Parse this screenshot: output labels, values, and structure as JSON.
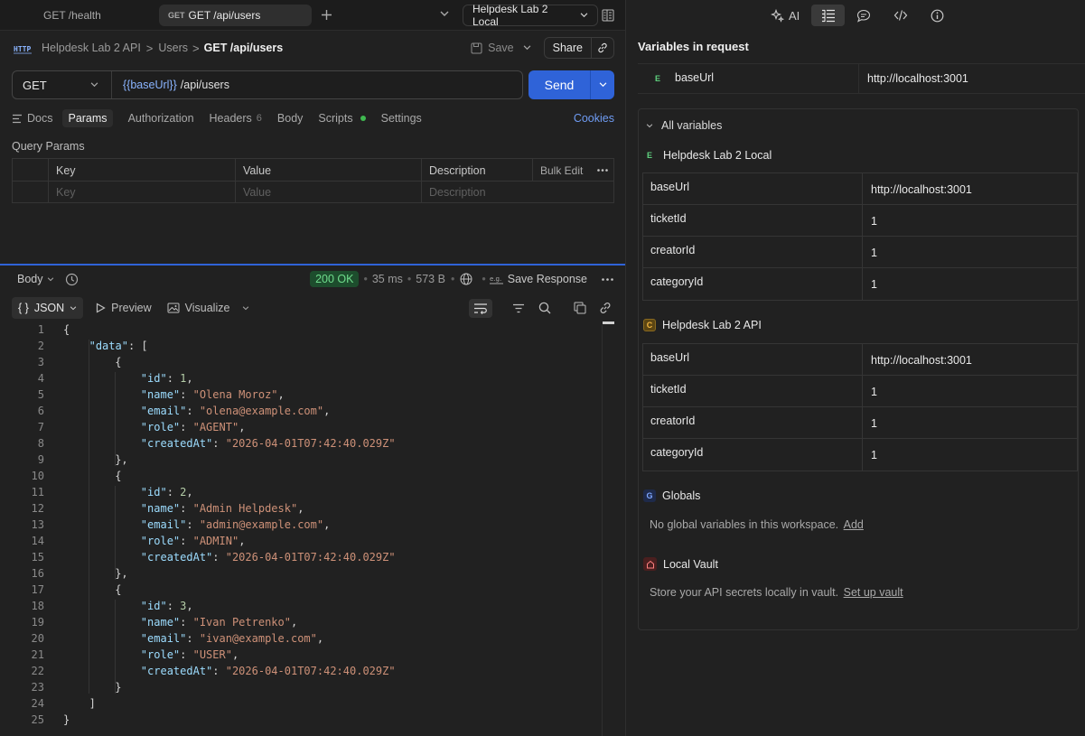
{
  "tabs": [
    {
      "method": "GET",
      "label": "GET /health"
    },
    {
      "method": "GET",
      "label": "GET /api/users"
    }
  ],
  "environment": "Helpdesk Lab 2 Local",
  "breadcrumb": {
    "collection": "Helpdesk Lab 2 API",
    "folder": "Users",
    "current": "GET /api/users",
    "separator": ">"
  },
  "toolbar": {
    "save": "Save",
    "share": "Share"
  },
  "request": {
    "method": "GET",
    "url_var": "{{baseUrl}}",
    "url_path": "/api/users",
    "send": "Send"
  },
  "req_tabs": {
    "docs": "Docs",
    "params": "Params",
    "authorization": "Authorization",
    "headers": "Headers",
    "headers_count": "6",
    "body": "Body",
    "scripts": "Scripts",
    "settings": "Settings",
    "cookies": "Cookies"
  },
  "query_params": {
    "title": "Query Params",
    "headers": [
      "Key",
      "Value",
      "Description",
      "Bulk Edit"
    ],
    "placeholders": [
      "Key",
      "Value",
      "Description"
    ]
  },
  "response": {
    "body_label": "Body",
    "status": "200 OK",
    "time": "35 ms",
    "size": "573 B",
    "save_response": "Save Response",
    "format": "JSON",
    "preview": "Preview",
    "visualize": "Visualize",
    "lines": [
      {
        "n": "1",
        "indent": 0,
        "tokens": [
          {
            "t": "p",
            "v": "{"
          }
        ]
      },
      {
        "n": "2",
        "indent": 1,
        "tokens": [
          {
            "t": "k",
            "v": "\"data\""
          },
          {
            "t": "p",
            "v": ": ["
          }
        ]
      },
      {
        "n": "3",
        "indent": 2,
        "tokens": [
          {
            "t": "p",
            "v": "{"
          }
        ]
      },
      {
        "n": "4",
        "indent": 3,
        "tokens": [
          {
            "t": "k",
            "v": "\"id\""
          },
          {
            "t": "p",
            "v": ": "
          },
          {
            "t": "n",
            "v": "1"
          },
          {
            "t": "p",
            "v": ","
          }
        ]
      },
      {
        "n": "5",
        "indent": 3,
        "tokens": [
          {
            "t": "k",
            "v": "\"name\""
          },
          {
            "t": "p",
            "v": ": "
          },
          {
            "t": "s",
            "v": "\"Olena Moroz\""
          },
          {
            "t": "p",
            "v": ","
          }
        ]
      },
      {
        "n": "6",
        "indent": 3,
        "tokens": [
          {
            "t": "k",
            "v": "\"email\""
          },
          {
            "t": "p",
            "v": ": "
          },
          {
            "t": "s",
            "v": "\"olena@example.com\""
          },
          {
            "t": "p",
            "v": ","
          }
        ]
      },
      {
        "n": "7",
        "indent": 3,
        "tokens": [
          {
            "t": "k",
            "v": "\"role\""
          },
          {
            "t": "p",
            "v": ": "
          },
          {
            "t": "s",
            "v": "\"AGENT\""
          },
          {
            "t": "p",
            "v": ","
          }
        ]
      },
      {
        "n": "8",
        "indent": 3,
        "tokens": [
          {
            "t": "k",
            "v": "\"createdAt\""
          },
          {
            "t": "p",
            "v": ": "
          },
          {
            "t": "s",
            "v": "\"2026-04-01T07:42:40.029Z\""
          }
        ]
      },
      {
        "n": "9",
        "indent": 2,
        "tokens": [
          {
            "t": "p",
            "v": "},"
          }
        ]
      },
      {
        "n": "10",
        "indent": 2,
        "tokens": [
          {
            "t": "p",
            "v": "{"
          }
        ]
      },
      {
        "n": "11",
        "indent": 3,
        "tokens": [
          {
            "t": "k",
            "v": "\"id\""
          },
          {
            "t": "p",
            "v": ": "
          },
          {
            "t": "n",
            "v": "2"
          },
          {
            "t": "p",
            "v": ","
          }
        ]
      },
      {
        "n": "12",
        "indent": 3,
        "tokens": [
          {
            "t": "k",
            "v": "\"name\""
          },
          {
            "t": "p",
            "v": ": "
          },
          {
            "t": "s",
            "v": "\"Admin Helpdesk\""
          },
          {
            "t": "p",
            "v": ","
          }
        ]
      },
      {
        "n": "13",
        "indent": 3,
        "tokens": [
          {
            "t": "k",
            "v": "\"email\""
          },
          {
            "t": "p",
            "v": ": "
          },
          {
            "t": "s",
            "v": "\"admin@example.com\""
          },
          {
            "t": "p",
            "v": ","
          }
        ]
      },
      {
        "n": "14",
        "indent": 3,
        "tokens": [
          {
            "t": "k",
            "v": "\"role\""
          },
          {
            "t": "p",
            "v": ": "
          },
          {
            "t": "s",
            "v": "\"ADMIN\""
          },
          {
            "t": "p",
            "v": ","
          }
        ]
      },
      {
        "n": "15",
        "indent": 3,
        "tokens": [
          {
            "t": "k",
            "v": "\"createdAt\""
          },
          {
            "t": "p",
            "v": ": "
          },
          {
            "t": "s",
            "v": "\"2026-04-01T07:42:40.029Z\""
          }
        ]
      },
      {
        "n": "16",
        "indent": 2,
        "tokens": [
          {
            "t": "p",
            "v": "},"
          }
        ]
      },
      {
        "n": "17",
        "indent": 2,
        "tokens": [
          {
            "t": "p",
            "v": "{"
          }
        ]
      },
      {
        "n": "18",
        "indent": 3,
        "tokens": [
          {
            "t": "k",
            "v": "\"id\""
          },
          {
            "t": "p",
            "v": ": "
          },
          {
            "t": "n",
            "v": "3"
          },
          {
            "t": "p",
            "v": ","
          }
        ]
      },
      {
        "n": "19",
        "indent": 3,
        "tokens": [
          {
            "t": "k",
            "v": "\"name\""
          },
          {
            "t": "p",
            "v": ": "
          },
          {
            "t": "s",
            "v": "\"Ivan Petrenko\""
          },
          {
            "t": "p",
            "v": ","
          }
        ]
      },
      {
        "n": "20",
        "indent": 3,
        "tokens": [
          {
            "t": "k",
            "v": "\"email\""
          },
          {
            "t": "p",
            "v": ": "
          },
          {
            "t": "s",
            "v": "\"ivan@example.com\""
          },
          {
            "t": "p",
            "v": ","
          }
        ]
      },
      {
        "n": "21",
        "indent": 3,
        "tokens": [
          {
            "t": "k",
            "v": "\"role\""
          },
          {
            "t": "p",
            "v": ": "
          },
          {
            "t": "s",
            "v": "\"USER\""
          },
          {
            "t": "p",
            "v": ","
          }
        ]
      },
      {
        "n": "22",
        "indent": 3,
        "tokens": [
          {
            "t": "k",
            "v": "\"createdAt\""
          },
          {
            "t": "p",
            "v": ": "
          },
          {
            "t": "s",
            "v": "\"2026-04-01T07:42:40.029Z\""
          }
        ]
      },
      {
        "n": "23",
        "indent": 2,
        "tokens": [
          {
            "t": "p",
            "v": "}"
          }
        ]
      },
      {
        "n": "24",
        "indent": 1,
        "tokens": [
          {
            "t": "p",
            "v": "]"
          }
        ]
      },
      {
        "n": "25",
        "indent": 0,
        "tokens": [
          {
            "t": "p",
            "v": "}"
          }
        ]
      }
    ]
  },
  "right_panel": {
    "ai_label": "AI",
    "title": "Variables in request",
    "request_var": {
      "tag": "E",
      "name": "baseUrl",
      "value": "http://localhost:3001"
    },
    "all_variables": "All variables",
    "local_env": {
      "tag": "E",
      "name": "Helpdesk Lab 2 Local",
      "rows": [
        {
          "key": "baseUrl",
          "value": "http://localhost:3001"
        },
        {
          "key": "ticketId",
          "value": "1"
        },
        {
          "key": "creatorId",
          "value": "1"
        },
        {
          "key": "categoryId",
          "value": "1"
        }
      ]
    },
    "collection": {
      "tag": "C",
      "name": "Helpdesk Lab 2 API",
      "rows": [
        {
          "key": "baseUrl",
          "value": "http://localhost:3001"
        },
        {
          "key": "ticketId",
          "value": "1"
        },
        {
          "key": "creatorId",
          "value": "1"
        },
        {
          "key": "categoryId",
          "value": "1"
        }
      ]
    },
    "globals": {
      "tag": "G",
      "name": "Globals",
      "text": "No global variables in this workspace.",
      "link": "Add"
    },
    "vault": {
      "name": "Local Vault",
      "text": "Store your API secrets locally in vault.",
      "link": "Set up vault"
    }
  },
  "colors": {
    "accent": "#2f63d8",
    "ok": "#6fdc8c",
    "key": "#9cdcfe",
    "string": "#ce9178",
    "number": "#b5cea8",
    "scripts_dot": "#3fb950"
  },
  "icons": [
    "plus-icon",
    "chevron-down-icon",
    "sidebar-layout-icon",
    "save-icon",
    "link-icon",
    "http-icon",
    "history-icon",
    "wrap-icon",
    "filter-icon",
    "search-icon",
    "copy-icon",
    "globe-icon",
    "ai-sparkle-icon",
    "variables-icon",
    "comment-icon",
    "code-icon",
    "info-icon",
    "vault-icon"
  ]
}
